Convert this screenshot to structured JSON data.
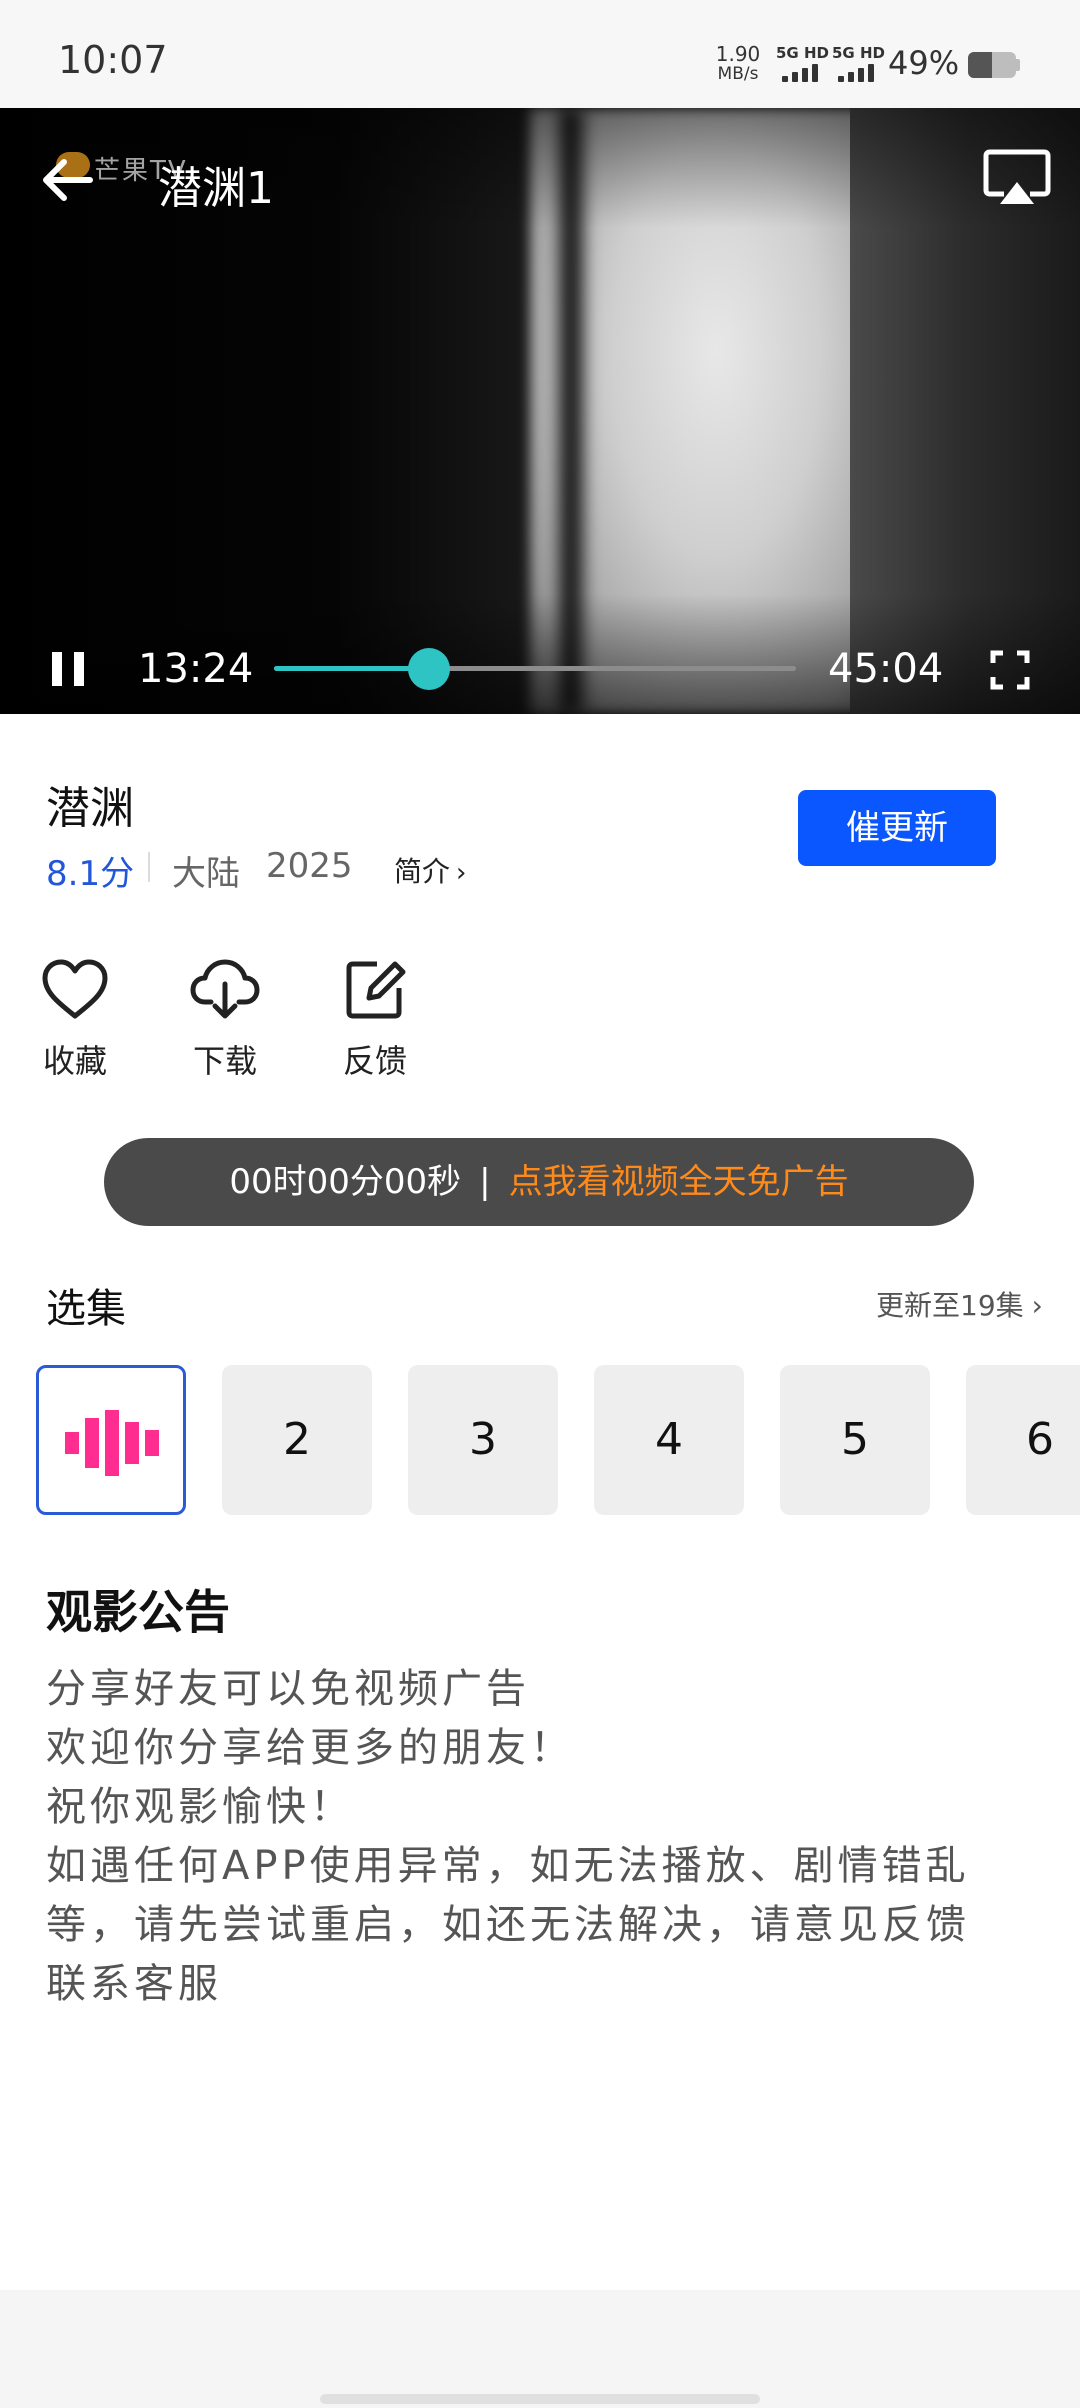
{
  "status_bar": {
    "time": "10:07",
    "net_speed_value": "1.90",
    "net_speed_unit": "MB/s",
    "signal_1": "5G HD",
    "signal_2": "5G HD",
    "battery_percent": "49%",
    "battery_level": 0.49
  },
  "player": {
    "watermark": "芒果TV",
    "title": "潜渊1",
    "current_time": "13:24",
    "total_time": "45:04",
    "progress": 0.297,
    "icons": {
      "back": "arrow-left-icon",
      "cast": "screen-cast-icon",
      "pause": "pause-icon",
      "fullscreen": "fullscreen-icon"
    },
    "accent_color": "#2ec4c4"
  },
  "show": {
    "title": "潜渊",
    "score": "8.1分",
    "region": "大陆",
    "year": "2025",
    "intro_label": "简介",
    "remind_button": "催更新",
    "score_color": "#2357d9",
    "button_color": "#0a57ff"
  },
  "actions": [
    {
      "label": "收藏",
      "icon": "heart-icon"
    },
    {
      "label": "下载",
      "icon": "cloud-download-icon"
    },
    {
      "label": "反馈",
      "icon": "feedback-edit-icon"
    }
  ],
  "ad_banner": {
    "timer": "00时00分00秒",
    "separator": "|",
    "cta": "点我看视频全天免广告",
    "cta_color": "#ff8a1a"
  },
  "episodes": {
    "title": "选集",
    "update_status": "更新至19集",
    "items": [
      {
        "label": "",
        "active": true,
        "icon": "playing-bars-icon"
      },
      {
        "label": "2",
        "active": false
      },
      {
        "label": "3",
        "active": false
      },
      {
        "label": "4",
        "active": false
      },
      {
        "label": "5",
        "active": false
      },
      {
        "label": "6",
        "active": false
      }
    ]
  },
  "notice": {
    "title": "观影公告",
    "lines": [
      "分享好友可以免视频广告",
      "欢迎你分享给更多的朋友！",
      "祝你观影愉快！",
      "如遇任何APP使用异常，如无法播放、剧情错乱",
      "等，请先尝试重启，如还无法解决，请意见反馈",
      "联系客服"
    ]
  }
}
